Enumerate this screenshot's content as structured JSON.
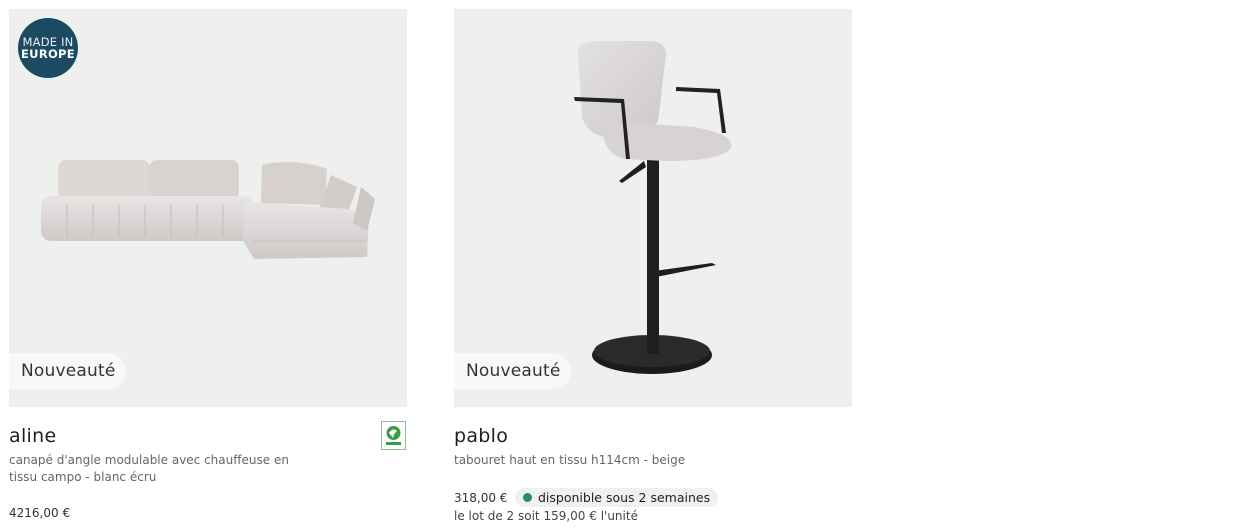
{
  "products": [
    {
      "badge": "Nouveauté",
      "origin_badge": {
        "line1": "MADE IN",
        "line2": "EUROPE"
      },
      "name": "aline",
      "description": "canapé d'angle modulable avec chauffeuse en tissu campo - blanc écru",
      "price": "4216,00 €",
      "certification_icon": "pefc-icon"
    },
    {
      "badge": "Nouveauté",
      "name": "pablo",
      "description": "tabouret haut en tissu h114cm - beige",
      "price": "318,00 €",
      "availability": "disponible sous 2 semaines",
      "availability_color": "#2e8b6a",
      "lot_info": "le lot de 2 soit 159,00 € l'unité"
    }
  ]
}
